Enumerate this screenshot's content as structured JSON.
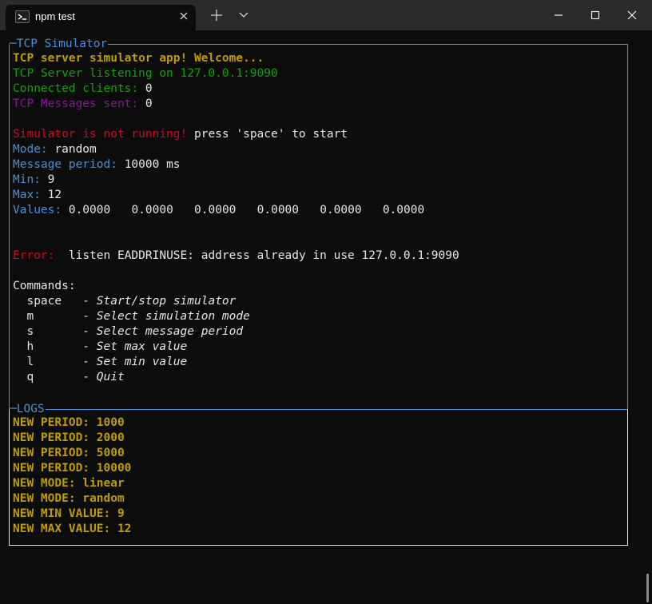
{
  "window": {
    "tab_title": "npm test"
  },
  "simulator": {
    "frame_title": "TCP Simulator",
    "welcome": "TCP server simulator app! Welcome...",
    "listening": "TCP Server listening on 127.0.0.1:9090",
    "connected_label": "Connected clients:",
    "connected_value": "0",
    "messages_label": "TCP Messages sent:",
    "messages_value": "0",
    "status_warning": "Simulator is not running!",
    "status_hint": "press 'space' to start",
    "mode_label": "Mode:",
    "mode_value": "random",
    "period_label": "Message period:",
    "period_value": "10000 ms",
    "min_label": "Min:",
    "min_value": "9",
    "max_label": "Max:",
    "max_value": "12",
    "values_label": "Values:",
    "values": [
      "0.0000",
      "0.0000",
      "0.0000",
      "0.0000",
      "0.0000",
      "0.0000"
    ],
    "error_label": "Error:",
    "error_message": "listen EADDRINUSE: address already in use 127.0.0.1:9090",
    "commands_header": "Commands:",
    "commands": [
      {
        "key": "space",
        "desc": "Start/stop simulator"
      },
      {
        "key": "m",
        "desc": "Select simulation mode"
      },
      {
        "key": "s",
        "desc": "Select message period"
      },
      {
        "key": "h",
        "desc": "Set max value"
      },
      {
        "key": "l",
        "desc": "Set min value"
      },
      {
        "key": "q",
        "desc": "Quit"
      }
    ]
  },
  "logs": {
    "frame_title": "LOGS",
    "entries": [
      "NEW PERIOD: 1000",
      "NEW PERIOD: 2000",
      "NEW PERIOD: 5000",
      "NEW PERIOD: 10000",
      "NEW MODE: linear",
      "NEW MODE: random",
      "NEW MIN VALUE: 9",
      "NEW MAX VALUE: 12"
    ]
  }
}
